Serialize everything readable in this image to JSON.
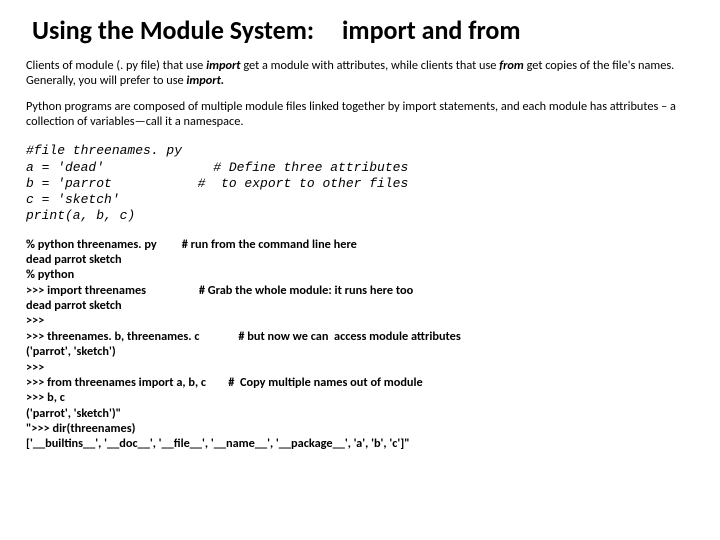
{
  "title_left": "Using the Module System:",
  "title_right": "import and from",
  "para1_a": "Clients of module (. py file) that use ",
  "para1_import": "import",
  "para1_b": " get a module with attributes, while clients that use ",
  "para1_from": "from",
  "para1_c": " get copies of the file's names. Generally, you will prefer to use ",
  "para1_import2": "import.",
  "para2": "Python programs are composed of multiple module files linked together by import statements, and each module has attributes – a collection of variables—call it a namespace.",
  "code_line1": "#file threenames. py",
  "code_line2": "a = 'dead'              # Define three attributes",
  "code_line3": "b = 'parrot           #  to export to other files",
  "code_line4": "c = 'sketch'",
  "code_line5": "print(a, b, c)",
  "sess_l1": "% python threenames. py         # run from the command line here",
  "sess_l2": "dead parrot sketch",
  "sess_l3": "% python",
  "sess_l4": ">>> import threenames                   # Grab the whole module: it runs here too",
  "sess_l5": "dead parrot sketch",
  "sess_l6": ">>>",
  "sess_l7": ">>> threenames. b, threenames. c              # but now we can  access module attributes",
  "sess_l8": "('parrot', 'sketch')",
  "sess_l9": ">>>",
  "sess_l10": ">>> from threenames import a, b, c        #  Copy multiple names out of module",
  "sess_l11": ">>> b, c",
  "sess_l12": "('parrot', 'sketch')\"",
  "sess_l13": "\">>> dir(threenames)",
  "sess_l14": "['__builtins__', '__doc__', '__file__', '__name__', '__package__', 'a', 'b', 'c']\""
}
